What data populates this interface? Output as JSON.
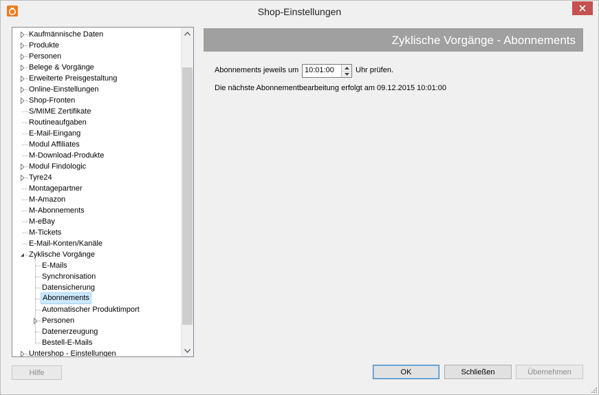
{
  "window": {
    "title": "Shop-Einstellungen"
  },
  "tree": {
    "items": [
      {
        "label": "Kaufmännische Daten",
        "level": 0,
        "expander": "collapsed"
      },
      {
        "label": "Produkte",
        "level": 0,
        "expander": "collapsed"
      },
      {
        "label": "Personen",
        "level": 0,
        "expander": "collapsed"
      },
      {
        "label": "Belege & Vorgänge",
        "level": 0,
        "expander": "collapsed"
      },
      {
        "label": "Erweiterte Preisgestaltung",
        "level": 0,
        "expander": "collapsed"
      },
      {
        "label": "Online-Einstellungen",
        "level": 0,
        "expander": "collapsed"
      },
      {
        "label": "Shop-Fronten",
        "level": 0,
        "expander": "collapsed"
      },
      {
        "label": "S/MIME Zertifikate",
        "level": 0,
        "expander": "none"
      },
      {
        "label": "Routineaufgaben",
        "level": 0,
        "expander": "none"
      },
      {
        "label": "E-Mail-Eingang",
        "level": 0,
        "expander": "none"
      },
      {
        "label": "Modul Affiliates",
        "level": 0,
        "expander": "none"
      },
      {
        "label": "M-Download-Produkte",
        "level": 0,
        "expander": "none"
      },
      {
        "label": "Modul Findologic",
        "level": 0,
        "expander": "collapsed"
      },
      {
        "label": "Tyre24",
        "level": 0,
        "expander": "collapsed"
      },
      {
        "label": "Montagepartner",
        "level": 0,
        "expander": "none"
      },
      {
        "label": "M-Amazon",
        "level": 0,
        "expander": "none"
      },
      {
        "label": "M-Abonnements",
        "level": 0,
        "expander": "none"
      },
      {
        "label": "M-eBay",
        "level": 0,
        "expander": "none"
      },
      {
        "label": "M-Tickets",
        "level": 0,
        "expander": "none"
      },
      {
        "label": "E-Mail-Konten/Kanäle",
        "level": 0,
        "expander": "none"
      },
      {
        "label": "Zyklische Vorgänge",
        "level": 0,
        "expander": "expanded"
      },
      {
        "label": "E-Mails",
        "level": 1,
        "expander": "none"
      },
      {
        "label": "Synchronisation",
        "level": 1,
        "expander": "none"
      },
      {
        "label": "Datensicherung",
        "level": 1,
        "expander": "none"
      },
      {
        "label": "Abonnements",
        "level": 1,
        "expander": "none",
        "selected": true
      },
      {
        "label": "Automatischer Produktimport",
        "level": 1,
        "expander": "none"
      },
      {
        "label": "Personen",
        "level": 1,
        "expander": "collapsed"
      },
      {
        "label": "Datenerzeugung",
        "level": 1,
        "expander": "none"
      },
      {
        "label": "Bestell-E-Mails",
        "level": 1,
        "expander": "none"
      },
      {
        "label": "Untershop - Einstellungen",
        "level": 0,
        "expander": "collapsed"
      }
    ]
  },
  "panel": {
    "header": "Zyklische Vorgänge - Abonnements",
    "check_prefix": "Abonnements jeweils um",
    "time_value": "10:01:00",
    "check_suffix": "Uhr prüfen.",
    "next_run_text": "Die nächste Abonnementbearbeitung erfolgt am 09.12.2015 10:01:00"
  },
  "buttons": {
    "help": "Hilfe",
    "ok": "OK",
    "close": "Schließen",
    "apply": "Übernehmen"
  },
  "colors": {
    "header_bg": "#a0a0a0",
    "selection_bg": "#cce8ff",
    "close_button": "#c75050",
    "app_icon": "#f07a1a"
  }
}
